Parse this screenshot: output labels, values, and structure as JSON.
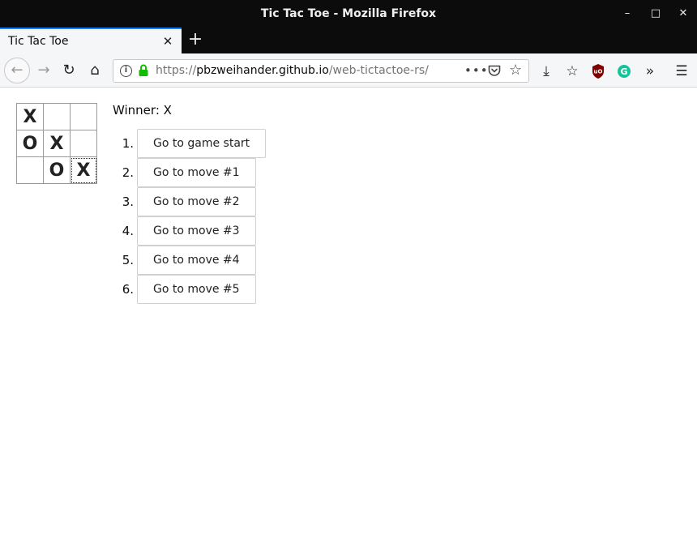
{
  "window": {
    "title": "Tic Tac Toe - Mozilla Firefox",
    "min_icon": "–",
    "max_icon": "□",
    "close_icon": "✕"
  },
  "tab": {
    "label": "Tic Tac Toe",
    "close_icon": "✕",
    "new_tab_icon": "+"
  },
  "nav": {
    "back_icon": "←",
    "forward_icon": "→",
    "reload_icon": "↻",
    "home_icon": "⌂"
  },
  "urlbar": {
    "scheme": "https://",
    "domain": "pbzweihander.github.io",
    "path": "/web-tictactoe-rs/",
    "info_icon": "i",
    "more_icon": "•••",
    "star_icon": "☆"
  },
  "toolbar": {
    "download_icon": "⤓",
    "library_icon": "☆",
    "overflow_icon": "»",
    "menu_icon": "☰"
  },
  "game": {
    "board": [
      [
        "X",
        "",
        ""
      ],
      [
        "O",
        "X",
        ""
      ],
      [
        "",
        "O",
        "X"
      ]
    ],
    "status": "Winner: X",
    "moves": [
      {
        "num": "1.",
        "label": "Go to game start"
      },
      {
        "num": "2.",
        "label": "Go to move #1"
      },
      {
        "num": "3.",
        "label": "Go to move #2"
      },
      {
        "num": "4.",
        "label": "Go to move #3"
      },
      {
        "num": "5.",
        "label": "Go to move #4"
      },
      {
        "num": "6.",
        "label": "Go to move #5"
      }
    ]
  }
}
